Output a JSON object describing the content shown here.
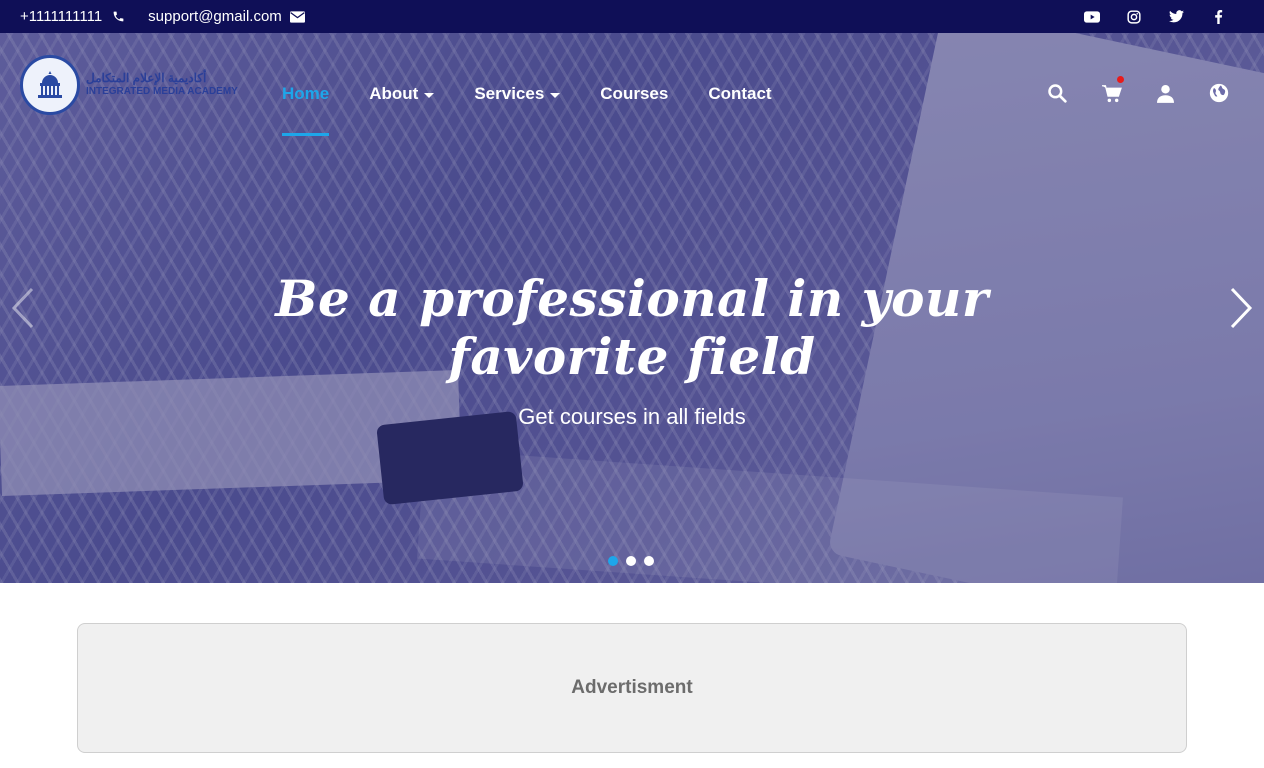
{
  "topbar": {
    "phone": "+1111111111",
    "email": "support@gmail.com",
    "social": [
      "youtube-icon",
      "instagram-icon",
      "twitter-icon",
      "facebook-icon"
    ]
  },
  "brand": {
    "arabic_name": "أكاديمية الإعلام المتكامل",
    "english_name": "INTEGRATED MEDIA ACADEMY"
  },
  "nav": {
    "items": [
      {
        "label": "Home",
        "active": true
      },
      {
        "label": "About",
        "dropdown": true
      },
      {
        "label": "Services",
        "dropdown": true
      },
      {
        "label": "Courses"
      },
      {
        "label": "Contact"
      }
    ],
    "icons": [
      "search-icon",
      "cart-icon",
      "user-icon",
      "globe-icon"
    ]
  },
  "hero": {
    "headline_line1": "Be a professional in your",
    "headline_line2": "favorite field",
    "subhead": "Get courses in all fields",
    "slides": 3,
    "active_slide": 1
  },
  "advert": {
    "label": "Advertisment"
  },
  "colors": {
    "topbar": "#0f0f57",
    "accent": "#1da6ea",
    "cart_dot": "#e81b1b"
  }
}
